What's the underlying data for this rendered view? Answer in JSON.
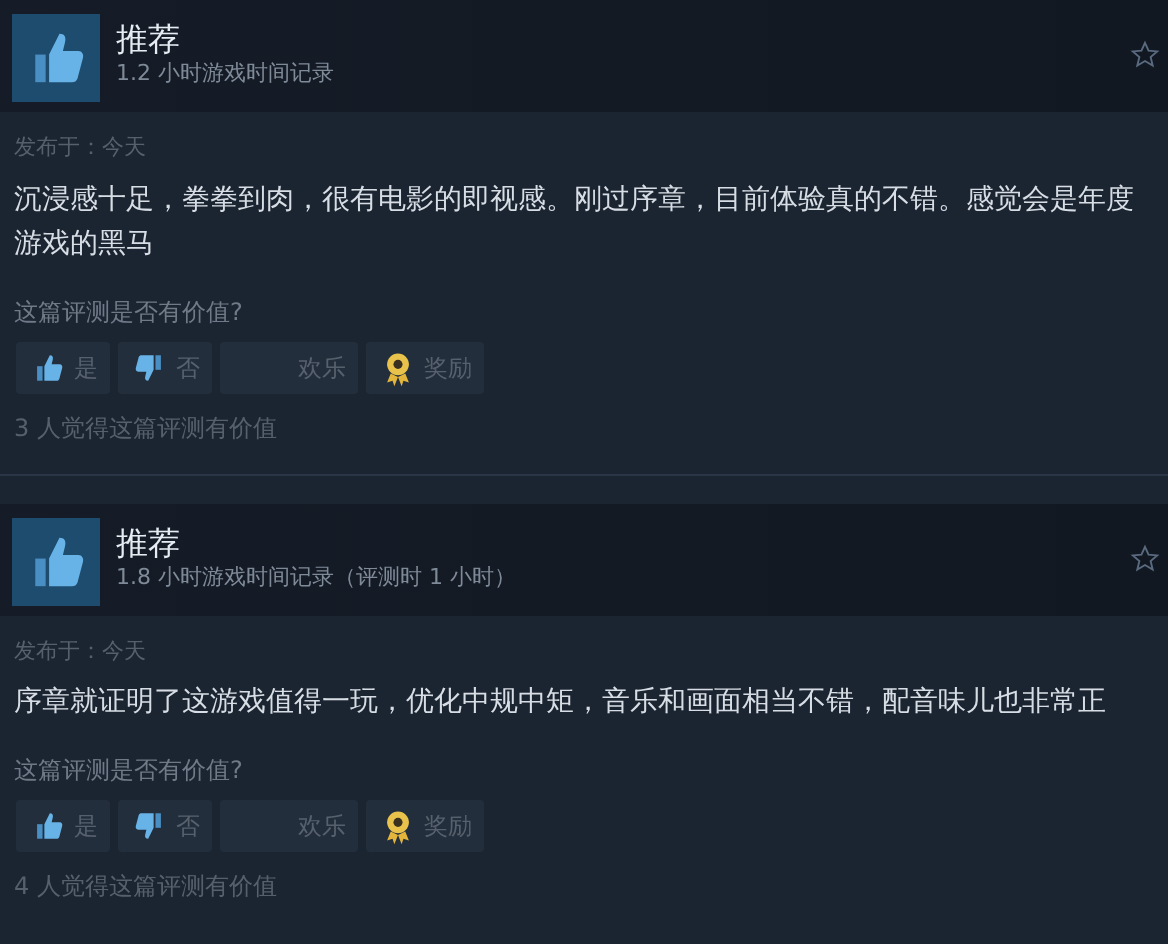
{
  "reviews": [
    {
      "verdict": "推荐",
      "hours": "1.2 小时游戏时间记录",
      "posted": "发布于：今天",
      "body": "沉浸感十足，拳拳到肉，很有电影的即视感。刚过序章，目前体验真的不错。感觉会是年度游戏的黑马",
      "question": "这篇评测是否有价值?",
      "buttons": [
        {
          "kind": "up",
          "label": "是"
        },
        {
          "kind": "down",
          "label": "否"
        },
        {
          "kind": "funny",
          "label": "欢乐"
        },
        {
          "kind": "award",
          "label": "奖励"
        }
      ],
      "helpful": "3 人觉得这篇评测有价值"
    },
    {
      "verdict": "推荐",
      "hours": "1.8 小时游戏时间记录（评测时 1 小时）",
      "posted": "发布于：今天",
      "body": "序章就证明了这游戏值得一玩，优化中规中矩，音乐和画面相当不错，配音味儿也非常正",
      "question": "这篇评测是否有价值?",
      "buttons": [
        {
          "kind": "up",
          "label": "是"
        },
        {
          "kind": "down",
          "label": "否"
        },
        {
          "kind": "funny",
          "label": "欢乐"
        },
        {
          "kind": "award",
          "label": "奖励"
        }
      ],
      "helpful": "4 人觉得这篇评测有价值"
    }
  ]
}
